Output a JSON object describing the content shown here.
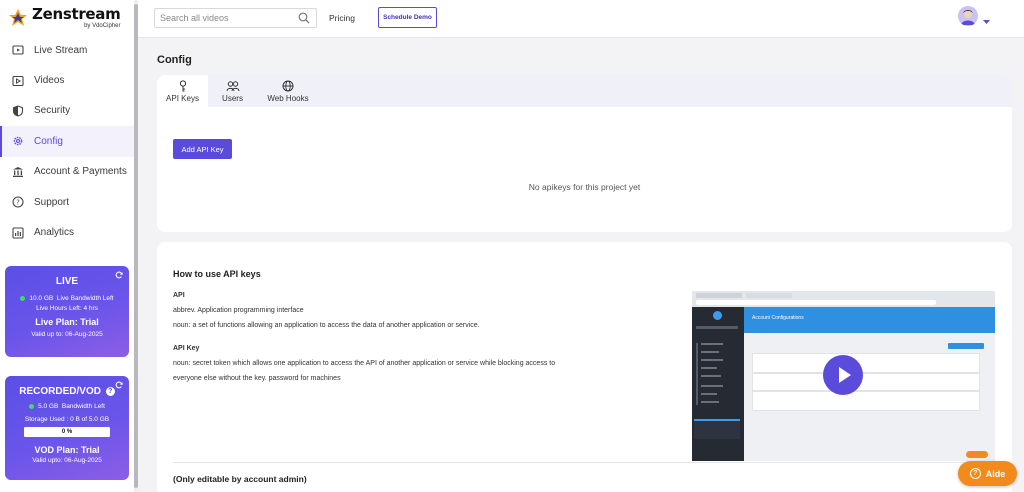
{
  "brand": {
    "name": "Zenstream",
    "sub": "by VdoCipher"
  },
  "sidebar": {
    "items": [
      {
        "label": "Live Stream",
        "icon": "live-stream-icon"
      },
      {
        "label": "Videos",
        "icon": "videos-icon"
      },
      {
        "label": "Security",
        "icon": "shield-icon"
      },
      {
        "label": "Config",
        "icon": "gear-icon",
        "active": true
      },
      {
        "label": "Account & Payments",
        "icon": "bank-icon"
      },
      {
        "label": "Support",
        "icon": "help-icon"
      },
      {
        "label": "Analytics",
        "icon": "analytics-icon"
      }
    ],
    "live_card": {
      "title": "LIVE",
      "bandwidth": "10.0 GB",
      "bandwidth_label": "Live Bandwidth Left",
      "hours": "Live Hours Left: 4 hrs",
      "plan": "Live Plan: Trial",
      "valid": "Valid up to: 06-Aug-2025"
    },
    "vod_card": {
      "title": "RECORDED/VOD",
      "bandwidth": "5.0 GB",
      "bandwidth_label": "Bandwidth Left",
      "storage": "Storage Used : 0 B of 5.0 GB",
      "progress_label": "0 %",
      "progress_value": 0,
      "plan": "VOD Plan: Trial",
      "valid": "Valid upto: 06-Aug-2025"
    }
  },
  "topbar": {
    "search_placeholder": "Search all videos",
    "pricing": "Pricing",
    "schedule_demo": "Schedule Demo"
  },
  "main": {
    "title": "Config",
    "tabs": [
      {
        "label": "API Keys",
        "icon": "key-icon",
        "active": true
      },
      {
        "label": "Users",
        "icon": "users-icon"
      },
      {
        "label": "Web Hooks",
        "icon": "globe-icon"
      }
    ],
    "add_button": "Add API Key",
    "empty_message": "No apikeys for this project yet",
    "how_title": "How to use API keys",
    "api_term": "API",
    "api_abbrev": "abbrev. Application programming interface",
    "api_noun": "noun: a set of functions allowing an application to access the data of another application or service.",
    "apikey_term": "API Key",
    "apikey_noun_1": "noun: secret token which allows one application to access the API of another application or service while blocking access to",
    "apikey_noun_2": "everyone else without the key. password for machines",
    "video_heading": "Account Configurations",
    "editable_note": "(Only editable by account admin)"
  },
  "aide": {
    "label": "Aide"
  },
  "colors": {
    "accent": "#5b4bdb",
    "aide": "#f28a1c",
    "live_dot": "#3ddc6b"
  }
}
